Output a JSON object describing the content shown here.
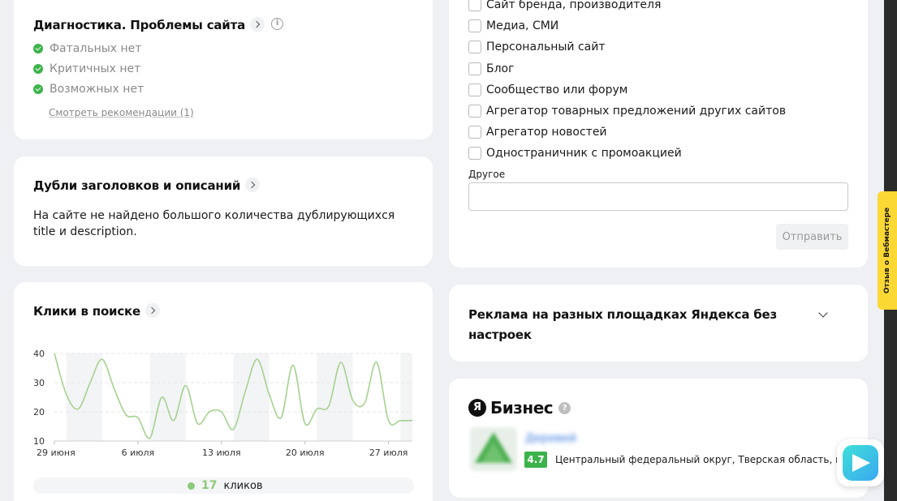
{
  "diagnostics": {
    "title": "Диагностика. Проблемы сайта",
    "items": [
      {
        "label": "Фатальных нет"
      },
      {
        "label": "Критичных нет"
      },
      {
        "label": "Возможных нет"
      }
    ],
    "recommendations_link": "Смотреть рекомендации (1)",
    "status_color": "#3cb34a"
  },
  "duplicates": {
    "title": "Дубли заголовков и описаний",
    "text": "На сайте не найдено большого количества дублирующихся title и description."
  },
  "clicks": {
    "title": "Клики в поиске",
    "total_value": "17",
    "total_label": "кликов"
  },
  "chart_data": {
    "type": "line",
    "title": "",
    "xlabel": "",
    "ylabel": "",
    "y_ticks": [
      40,
      30,
      20,
      10
    ],
    "ylim": [
      10,
      40
    ],
    "x_tick_labels": [
      "29 июня",
      "6 июля",
      "13 июля",
      "20 июля",
      "27 июля"
    ],
    "x_tick_days": [
      0,
      7,
      14,
      21,
      28
    ],
    "xlim": [
      0,
      30
    ],
    "grid": true,
    "series": [
      {
        "color": "#a5d28f",
        "x": [
          0,
          1,
          2,
          3,
          4,
          5,
          6,
          7,
          8,
          9,
          10,
          11,
          12,
          13,
          14,
          15,
          16,
          17,
          18,
          19,
          20,
          21,
          22,
          23,
          24,
          25,
          26,
          27,
          28,
          29,
          30
        ],
        "y": [
          40,
          26,
          21,
          30,
          38,
          28,
          19,
          18,
          11,
          25,
          17,
          29,
          16,
          20,
          20,
          14,
          27,
          38,
          26,
          18,
          36,
          16,
          21,
          22,
          37,
          24,
          23,
          37,
          17,
          17,
          17
        ]
      }
    ]
  },
  "site_type": {
    "options": [
      {
        "label": "Сайт бренда, производителя"
      },
      {
        "label": "Медиа, СМИ"
      },
      {
        "label": "Персональный сайт"
      },
      {
        "label": "Блог"
      },
      {
        "label": "Сообщество или форум"
      },
      {
        "label": "Агрегатор товарных предложений других сайтов"
      },
      {
        "label": "Агрегатор новостей"
      },
      {
        "label": "Одностраничник с промоакцией"
      }
    ],
    "other_label": "Другое",
    "other_value": "",
    "send_label": "Отправить"
  },
  "ads": {
    "title": "Реклама на разных площадках Яндекса без настроек"
  },
  "business": {
    "logo_letter": "Я",
    "logo_text": "Бизнес",
    "help_glyph": "?",
    "name": "Деревей",
    "rating": "4.7",
    "address": "Центральный федеральный округ, Тверская область, город"
  },
  "feedback_tab": {
    "label": "Отзыв о Вебмастере"
  }
}
